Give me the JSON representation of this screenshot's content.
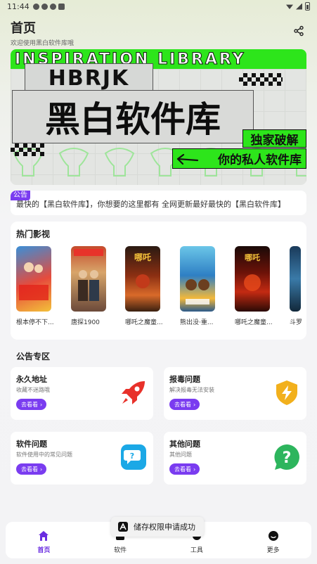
{
  "status_bar": {
    "time": "11:44"
  },
  "header": {
    "title": "首页",
    "subtitle": "欢迎使用黑白软件库哦"
  },
  "banner": {
    "stripe_text": "INSPIRATION LIBRARY",
    "brand": "HBRJK",
    "title": "黑白软件库",
    "tag_exclusive": "独家破解",
    "tag_private": "你的私人软件库"
  },
  "notice": {
    "badge": "公告",
    "text": "最快的【黑白软件库】，你想要的这里都有  全网更新最好最快的【黑白软件库】"
  },
  "hot": {
    "title": "热门影视",
    "movies": [
      {
        "name": "根本停不下..."
      },
      {
        "name": "唐探1900"
      },
      {
        "name": "哪吒之魔童..."
      },
      {
        "name": "熊出没·重..."
      },
      {
        "name": "哪吒之魔童..."
      },
      {
        "name": "斗罗"
      }
    ]
  },
  "announcements": {
    "title": "公告专区",
    "cards": [
      {
        "title": "永久地址",
        "desc": "收藏不迷路哦",
        "button": "去看看"
      },
      {
        "title": "报毒问题",
        "desc": "解决报毒无法安装",
        "button": "去看看"
      },
      {
        "title": "软件问题",
        "desc": "软件使用中的常见问题",
        "button": "去看看"
      },
      {
        "title": "其他问题",
        "desc": "其他问题",
        "button": "去看看"
      }
    ]
  },
  "toast": {
    "text": "储存权限申请成功"
  },
  "nav": {
    "items": [
      {
        "label": "首页"
      },
      {
        "label": "软件"
      },
      {
        "label": "工具"
      },
      {
        "label": "更多"
      }
    ]
  }
}
